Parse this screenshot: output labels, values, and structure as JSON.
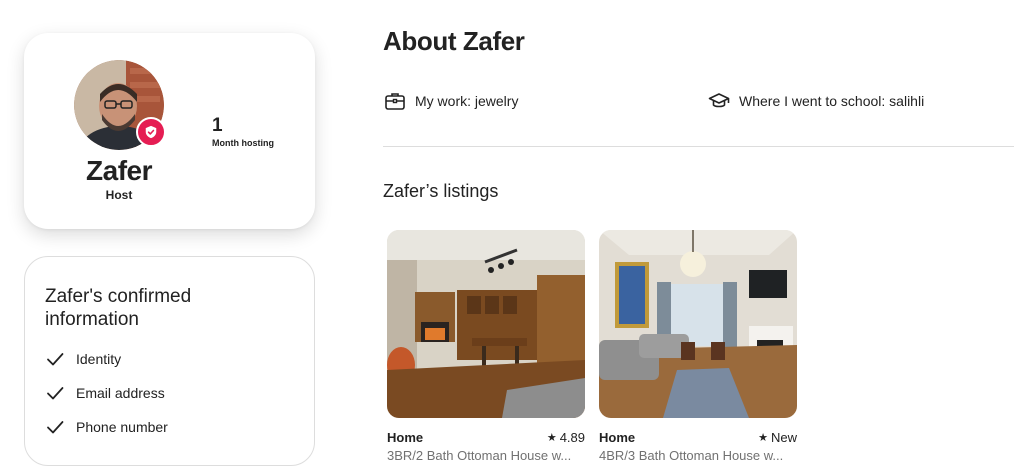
{
  "host": {
    "name": "Zafer",
    "role": "Host",
    "stat_value": "1",
    "stat_label": "Month hosting",
    "avatar_icon": "host-avatar",
    "badge_icon": "verified-shield-icon",
    "badge_color": "#E51D53"
  },
  "confirmed": {
    "title": "Zafer's confirmed information",
    "items": [
      {
        "label": "Identity",
        "icon": "checkmark-icon"
      },
      {
        "label": "Email address",
        "icon": "checkmark-icon"
      },
      {
        "label": "Phone number",
        "icon": "checkmark-icon"
      }
    ]
  },
  "about": {
    "title": "About Zafer",
    "facts": [
      {
        "icon": "briefcase-icon",
        "text": "My work: jewelry"
      },
      {
        "icon": "graduation-cap-icon",
        "text": "Where I went to school: salihli"
      }
    ]
  },
  "listings": {
    "title": "Zafer’s listings",
    "items": [
      {
        "type": "Home",
        "rating": "4.89",
        "title": "3BR/2 Bath Ottoman House w...",
        "photo": "kitchen-dining-room-photo"
      },
      {
        "type": "Home",
        "rating": "New",
        "title": "4BR/3 Bath Ottoman House w...",
        "photo": "living-room-photo"
      }
    ]
  },
  "colors": {
    "text": "#222222",
    "muted": "#717171",
    "border": "#DDDDDD",
    "brand": "#E51D53"
  }
}
